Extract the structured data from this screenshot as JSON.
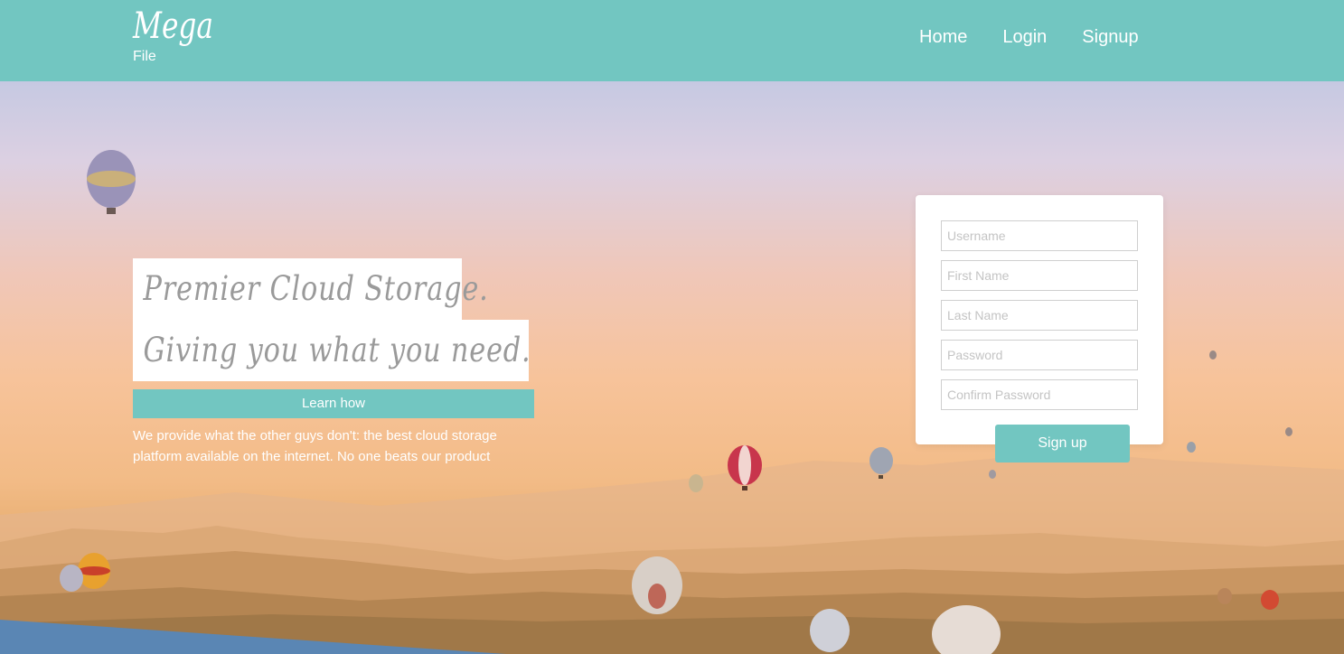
{
  "header": {
    "logo_main": "Mega",
    "logo_sub": "File",
    "nav": [
      {
        "label": "Home"
      },
      {
        "label": "Login"
      },
      {
        "label": "Signup"
      }
    ]
  },
  "hero": {
    "headline_line1": "Premier Cloud Storage.",
    "headline_line2": "Giving you what you need.",
    "cta_label": "Learn how",
    "description": "We provide what the other guys don't: the best cloud storage platform available on the internet. No one beats our product"
  },
  "signup_form": {
    "username_placeholder": "Username",
    "first_name_placeholder": "First Name",
    "last_name_placeholder": "Last Name",
    "password_placeholder": "Password",
    "confirm_password_placeholder": "Confirm Password",
    "submit_label": "Sign up"
  },
  "colors": {
    "accent": "#72c6c1",
    "white": "#ffffff"
  }
}
